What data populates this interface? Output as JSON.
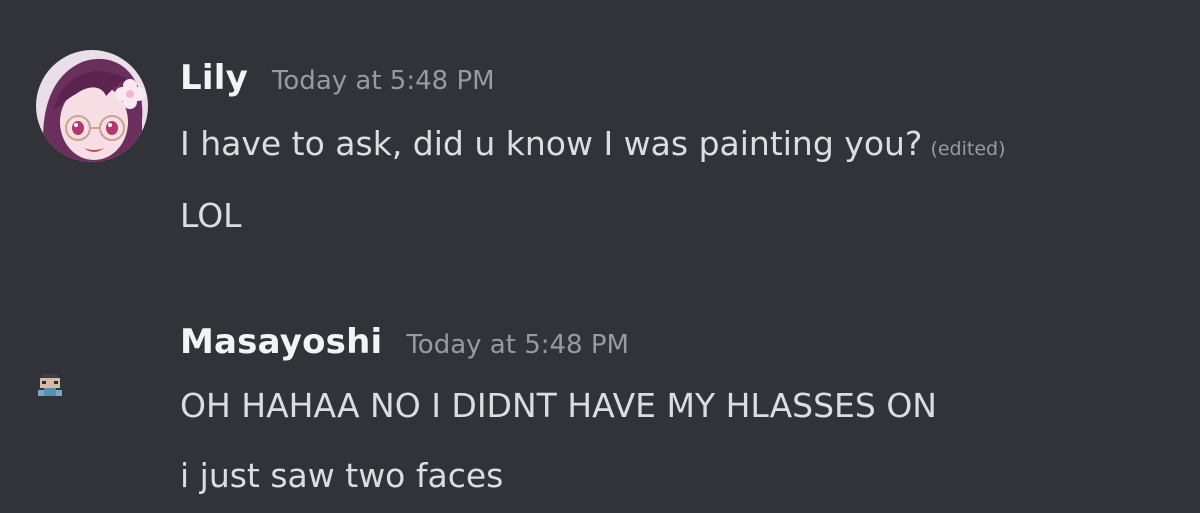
{
  "messages": [
    {
      "author": "Lily",
      "timestamp": "Today at 5:48 PM",
      "lines": [
        {
          "text": "I have to ask, did u know I was painting you?",
          "edited": "(edited)"
        },
        {
          "text": "LOL"
        }
      ],
      "avatar_icon": "anime-girl-avatar-icon"
    },
    {
      "author": "Masayoshi",
      "timestamp": "Today at 5:48 PM",
      "lines": [
        {
          "text": "OH HAHAA NO I DIDNT HAVE MY HLASSES ON"
        },
        {
          "text": "i just saw two faces"
        }
      ],
      "avatar_icon": "pixel-character-avatar-icon"
    }
  ],
  "colors": {
    "background": "#313338",
    "username": "#f2f3f5",
    "text": "#dbdee1",
    "muted": "#949ba4",
    "avatar_hair": "#6b2f5e",
    "avatar_skin": "#f7dde4"
  }
}
